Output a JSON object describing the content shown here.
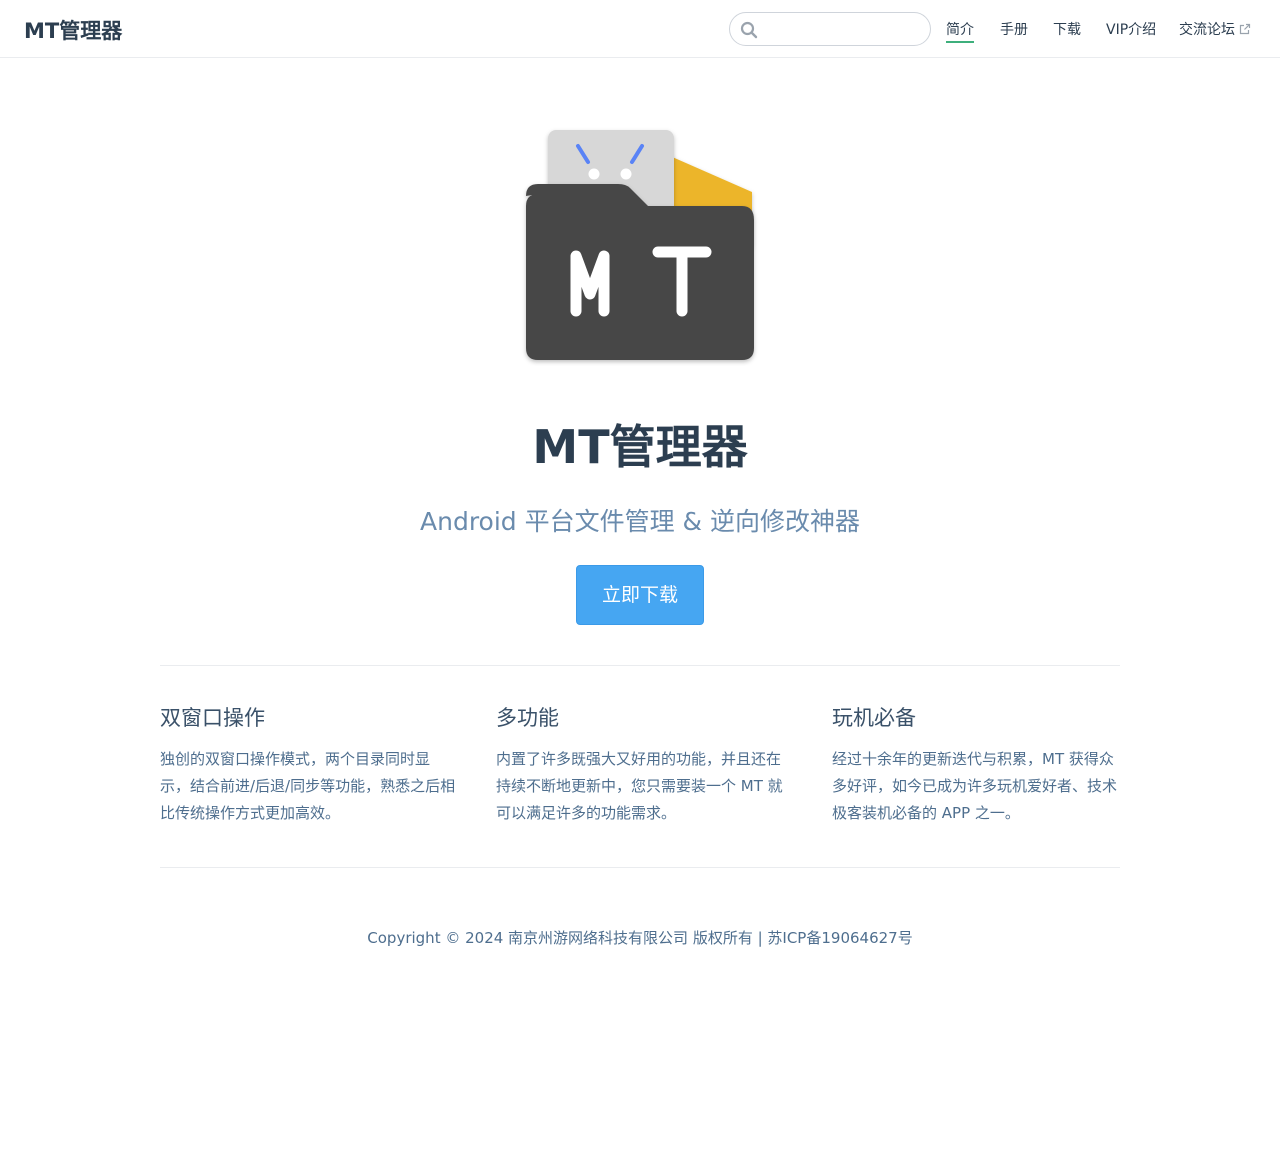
{
  "navbar": {
    "site_name": "MT管理器",
    "search": {
      "placeholder": "",
      "value": "",
      "icon": "search-icon"
    },
    "links": [
      {
        "label": "简介",
        "active": true
      },
      {
        "label": "手册",
        "active": false
      },
      {
        "label": "下载",
        "active": false
      },
      {
        "label": "VIP介绍",
        "active": false
      },
      {
        "label": "交流论坛",
        "active": false,
        "icon": "external-link-icon"
      }
    ]
  },
  "hero": {
    "title": "MT管理器",
    "description": "Android 平台文件管理 & 逆向修改神器",
    "action_label": "立即下载",
    "logo": {
      "letters": "M T",
      "colors": {
        "folder": "#474747",
        "android": "#5983f6",
        "paper": "#d7d7d7",
        "yellow": "#ecb52b"
      }
    }
  },
  "features": [
    {
      "title": "双窗口操作",
      "details": "独创的双窗口操作模式，两个目录同时显示，结合前进/后退/同步等功能，熟悉之后相比传统操作方式更加高效。"
    },
    {
      "title": "多功能",
      "details": "内置了许多既强大又好用的功能，并且还在持续不断地更新中，您只需要装一个 MT 就可以满足许多的功能需求。"
    },
    {
      "title": "玩机必备",
      "details": "经过十余年的更新迭代与积累，MT 获得众多好评，如今已成为许多玩机爱好者、技术极客装机必备的 APP 之一。"
    }
  ],
  "footer": {
    "text": "Copyright © 2024 南京州游网络科技有限公司 版权所有 | 苏ICP备19064627号"
  },
  "colors": {
    "accent": "#3eaf7c",
    "button": "#46a6f2",
    "text": "#2c3e50",
    "muted": "#6a8bad"
  }
}
